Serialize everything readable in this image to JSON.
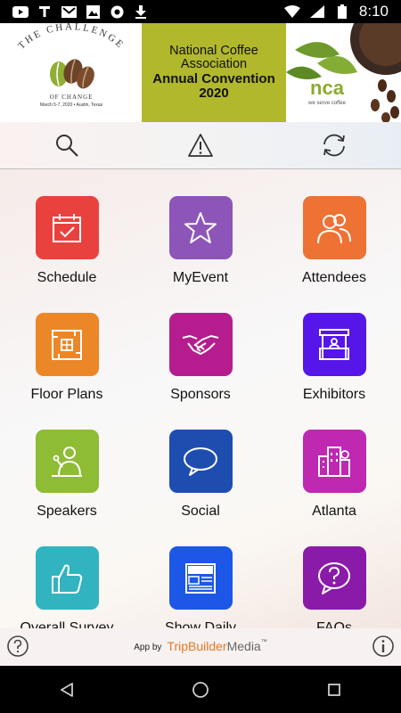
{
  "status_bar": {
    "time": "8:10",
    "icons": [
      "youtube-icon",
      "t-icon",
      "gmail-icon",
      "photo-icon",
      "record-icon",
      "download-icon",
      "wifi-icon",
      "signal-icon",
      "battery-icon"
    ]
  },
  "banner": {
    "logo_top": "THE CHALLENGE",
    "logo_bottom": "OF CHANGE",
    "logo_date": "March 5-7, 2020 • Austin, Texas",
    "line1": "National Coffee",
    "line2": "Association",
    "line3": "Annual Convention",
    "line4": "2020",
    "nca_logo": "nca",
    "nca_tagline": "we serve coffee"
  },
  "toolbar": {
    "icons": [
      "search-icon",
      "alert-icon",
      "refresh-icon"
    ]
  },
  "tiles": [
    {
      "label": "Schedule",
      "color": "#e9423e",
      "icon": "calendar-check-icon"
    },
    {
      "label": "MyEvent",
      "color": "#8e55b8",
      "icon": "star-icon"
    },
    {
      "label": "Attendees",
      "color": "#ee7234",
      "icon": "people-icon"
    },
    {
      "label": "Floor Plans",
      "color": "#ec8727",
      "icon": "floor-plan-icon"
    },
    {
      "label": "Sponsors",
      "color": "#b51d8e",
      "icon": "handshake-icon"
    },
    {
      "label": "Exhibitors",
      "color": "#5716e8",
      "icon": "booth-icon"
    },
    {
      "label": "Speakers",
      "color": "#8ebc35",
      "icon": "speaker-icon"
    },
    {
      "label": "Social",
      "color": "#1e4db0",
      "icon": "speech-bubble-icon"
    },
    {
      "label": "Atlanta",
      "color": "#bf28b0",
      "icon": "city-icon"
    },
    {
      "label": "Overall Survey",
      "color": "#31b4c0",
      "icon": "thumbs-up-icon"
    },
    {
      "label": "Show Daily",
      "color": "#1d57e8",
      "icon": "news-icon"
    },
    {
      "label": "FAQs",
      "color": "#8a1aa8",
      "icon": "question-bubble-icon"
    }
  ],
  "footer": {
    "app_by": "App by",
    "brand_part1": "TripBuilder",
    "brand_part2": "Media",
    "trademark": "™"
  },
  "nav_bar": {
    "icons": [
      "back-icon",
      "home-icon",
      "recents-icon"
    ]
  }
}
